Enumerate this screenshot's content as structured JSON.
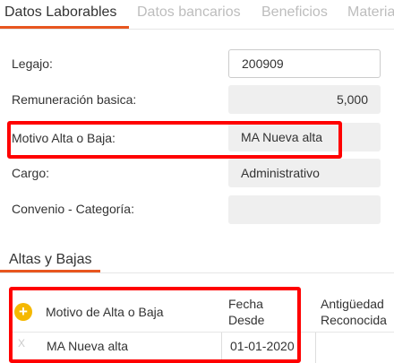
{
  "tabs": [
    {
      "label": "Datos Laborables",
      "active": true
    },
    {
      "label": "Datos bancarios",
      "active": false
    },
    {
      "label": "Beneficios",
      "active": false
    },
    {
      "label": "Materia",
      "active": false
    }
  ],
  "form": {
    "legajo_label": "Legajo:",
    "legajo_value": "200909",
    "remuneracion_label": "Remuneración basica:",
    "remuneracion_value": "5,000",
    "motivo_label": "Motivo Alta o Baja:",
    "motivo_value": "MA Nueva alta",
    "cargo_label": "Cargo:",
    "cargo_value": "Administrativo",
    "convenio_label": "Convenio - Categoría:",
    "convenio_value": ""
  },
  "section": {
    "title": "Altas y Bajas"
  },
  "table": {
    "headers": {
      "motivo": "Motivo de Alta o Baja",
      "fecha_line1": "Fecha",
      "fecha_line2": "Desde",
      "antiguedad_line1": "Antigüedad",
      "antiguedad_line2": "Reconocida"
    },
    "add_icon_glyph": "+",
    "remove_icon_glyph": "X",
    "rows": [
      {
        "motivo": "MA Nueva alta",
        "fecha": "01-01-2020",
        "antiguedad": ""
      }
    ]
  },
  "colors": {
    "accent": "#e8561f",
    "highlight": "#ff0000",
    "add_icon": "#f5b800"
  }
}
